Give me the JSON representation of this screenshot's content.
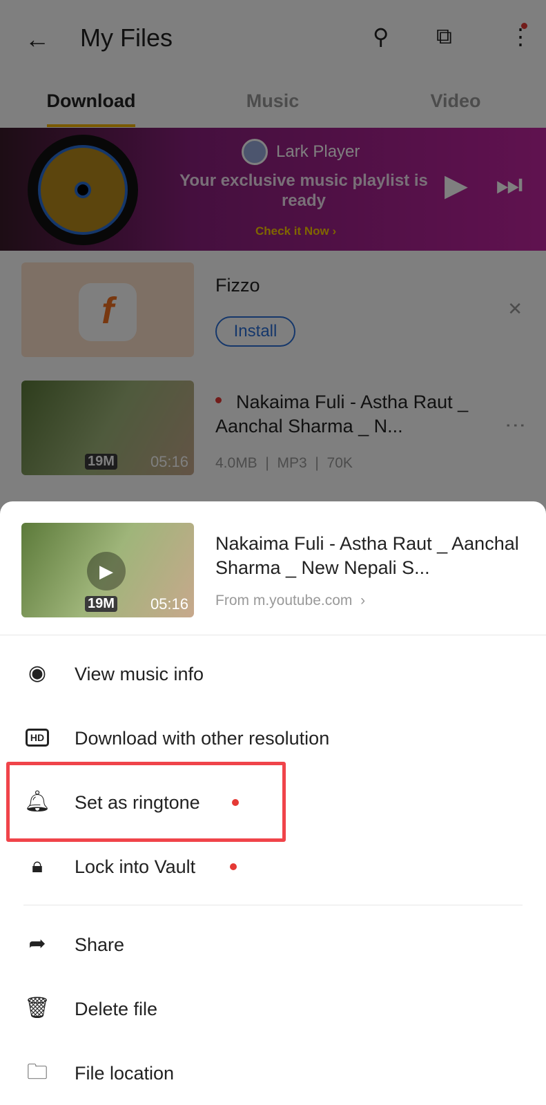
{
  "header": {
    "title": "My Files",
    "back_icon": "arrow-left-icon",
    "search_icon": "search-icon",
    "select_icon": "multi-select-icon",
    "more_icon": "more-vertical-icon"
  },
  "tabs": [
    {
      "label": "Download",
      "active": true
    },
    {
      "label": "Music",
      "active": false
    },
    {
      "label": "Video",
      "active": false
    }
  ],
  "banner": {
    "brand": "Lark Player",
    "headline": "Your exclusive music playlist is ready",
    "cta": "Check it Now ›"
  },
  "ad_item": {
    "title": "Fizzo",
    "logo_text": "f",
    "install_label": "Install",
    "close_icon": "close-icon"
  },
  "file_item": {
    "title": "Nakaima Fuli - Astha Raut _ Aanchal Sharma _ N...",
    "size": "4.0MB",
    "format": "MP3",
    "bitrate": "70K",
    "duration": "05:16",
    "views_badge": "19M",
    "separator": "|"
  },
  "sheet": {
    "title": "Nakaima Fuli - Astha Raut _ Aanchal Sharma _ New Nepali S...",
    "source": "From m.youtube.com",
    "source_chevron": "›",
    "duration": "05:16",
    "views_badge": "19M",
    "menu": [
      {
        "label": "View music info",
        "icon": "disc-icon",
        "dot": false
      },
      {
        "label": "Download with other resolution",
        "icon": "hd-icon",
        "dot": false
      },
      {
        "label": "Set as ringtone",
        "icon": "bell-icon",
        "dot": true,
        "highlighted": true
      },
      {
        "label": "Lock into Vault",
        "icon": "lock-icon",
        "dot": true
      },
      {
        "label": "Share",
        "icon": "share-icon",
        "dot": false
      },
      {
        "label": "Delete file",
        "icon": "trash-icon",
        "dot": false
      },
      {
        "label": "File location",
        "icon": "folder-search-icon",
        "dot": false
      }
    ]
  },
  "colors": {
    "accent": "#f5b400",
    "highlight": "#f0444a",
    "dot": "#e53935",
    "link": "#2a6fd6"
  }
}
